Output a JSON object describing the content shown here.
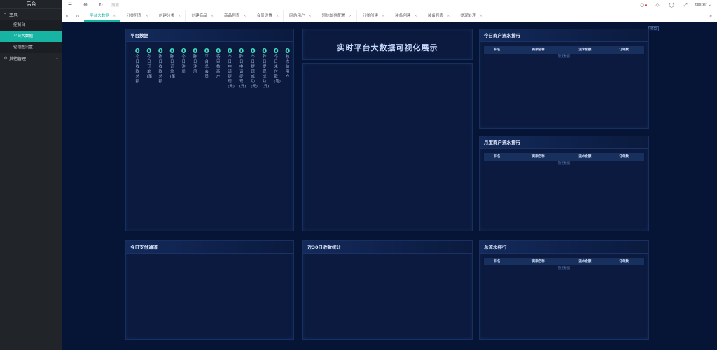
{
  "brand": "后台",
  "sidebar": {
    "groups": [
      {
        "label": "主页",
        "icon": "home-icon",
        "expanded": true,
        "items": [
          {
            "label": "控制台",
            "active": false
          },
          {
            "label": "平台大数据",
            "active": true
          },
          {
            "label": "轮播图设置",
            "active": false
          }
        ]
      },
      {
        "label": "其他管理",
        "icon": "settings-icon",
        "expanded": false,
        "items": []
      }
    ]
  },
  "topbar": {
    "search_placeholder": "搜索...",
    "user": "tester"
  },
  "tabs": [
    {
      "label": "平台大数据",
      "active": true
    },
    {
      "label": "分类列表",
      "active": false
    },
    {
      "label": "创建分类",
      "active": false
    },
    {
      "label": "创建商品",
      "active": false
    },
    {
      "label": "商品列表",
      "active": false
    },
    {
      "label": "会员设置",
      "active": false
    },
    {
      "label": "网站用户",
      "active": false
    },
    {
      "label": "短信邮件配置",
      "active": false
    },
    {
      "label": "分类创建",
      "active": false
    },
    {
      "label": "装备创建",
      "active": false
    },
    {
      "label": "装备列表",
      "active": false
    },
    {
      "label": "提现处理",
      "active": false
    }
  ],
  "exit_label": "退出",
  "platform": {
    "title": "平台数据",
    "stats": [
      {
        "value": "0",
        "label": "今日收款总额"
      },
      {
        "value": "0",
        "label": "今日订单(笔)"
      },
      {
        "value": "0",
        "label": "昨日收款总额"
      },
      {
        "value": "0",
        "label": "昨日订单(笔)"
      },
      {
        "value": "0",
        "label": "今日注册"
      },
      {
        "value": "0",
        "label": "昨日注册"
      },
      {
        "value": "0",
        "label": "平台总会员"
      },
      {
        "value": "0",
        "label": "待审核商户"
      },
      {
        "value": "0",
        "label": "今日申请提现(元)"
      },
      {
        "value": "0",
        "label": "昨日申请提现(元)"
      },
      {
        "value": "0",
        "label": "今日提现成功(元)"
      },
      {
        "value": "0",
        "label": "昨日提现成功(元)"
      },
      {
        "value": "0",
        "label": "今日未付款(笔)"
      },
      {
        "value": "0",
        "label": "总冻结用户"
      }
    ]
  },
  "center_title": "实时平台大数据可视化展示",
  "panels": {
    "today_channel": "今日支付通道",
    "last30": "近30日收款统计"
  },
  "rank_headers": [
    "排名",
    "商家名称",
    "流水金额",
    "订单数"
  ],
  "empty_text": "暂无数据",
  "ranks": [
    {
      "title": "今日商户流水排行"
    },
    {
      "title": "月度商户流水排行"
    },
    {
      "title": "总流水排行"
    }
  ]
}
